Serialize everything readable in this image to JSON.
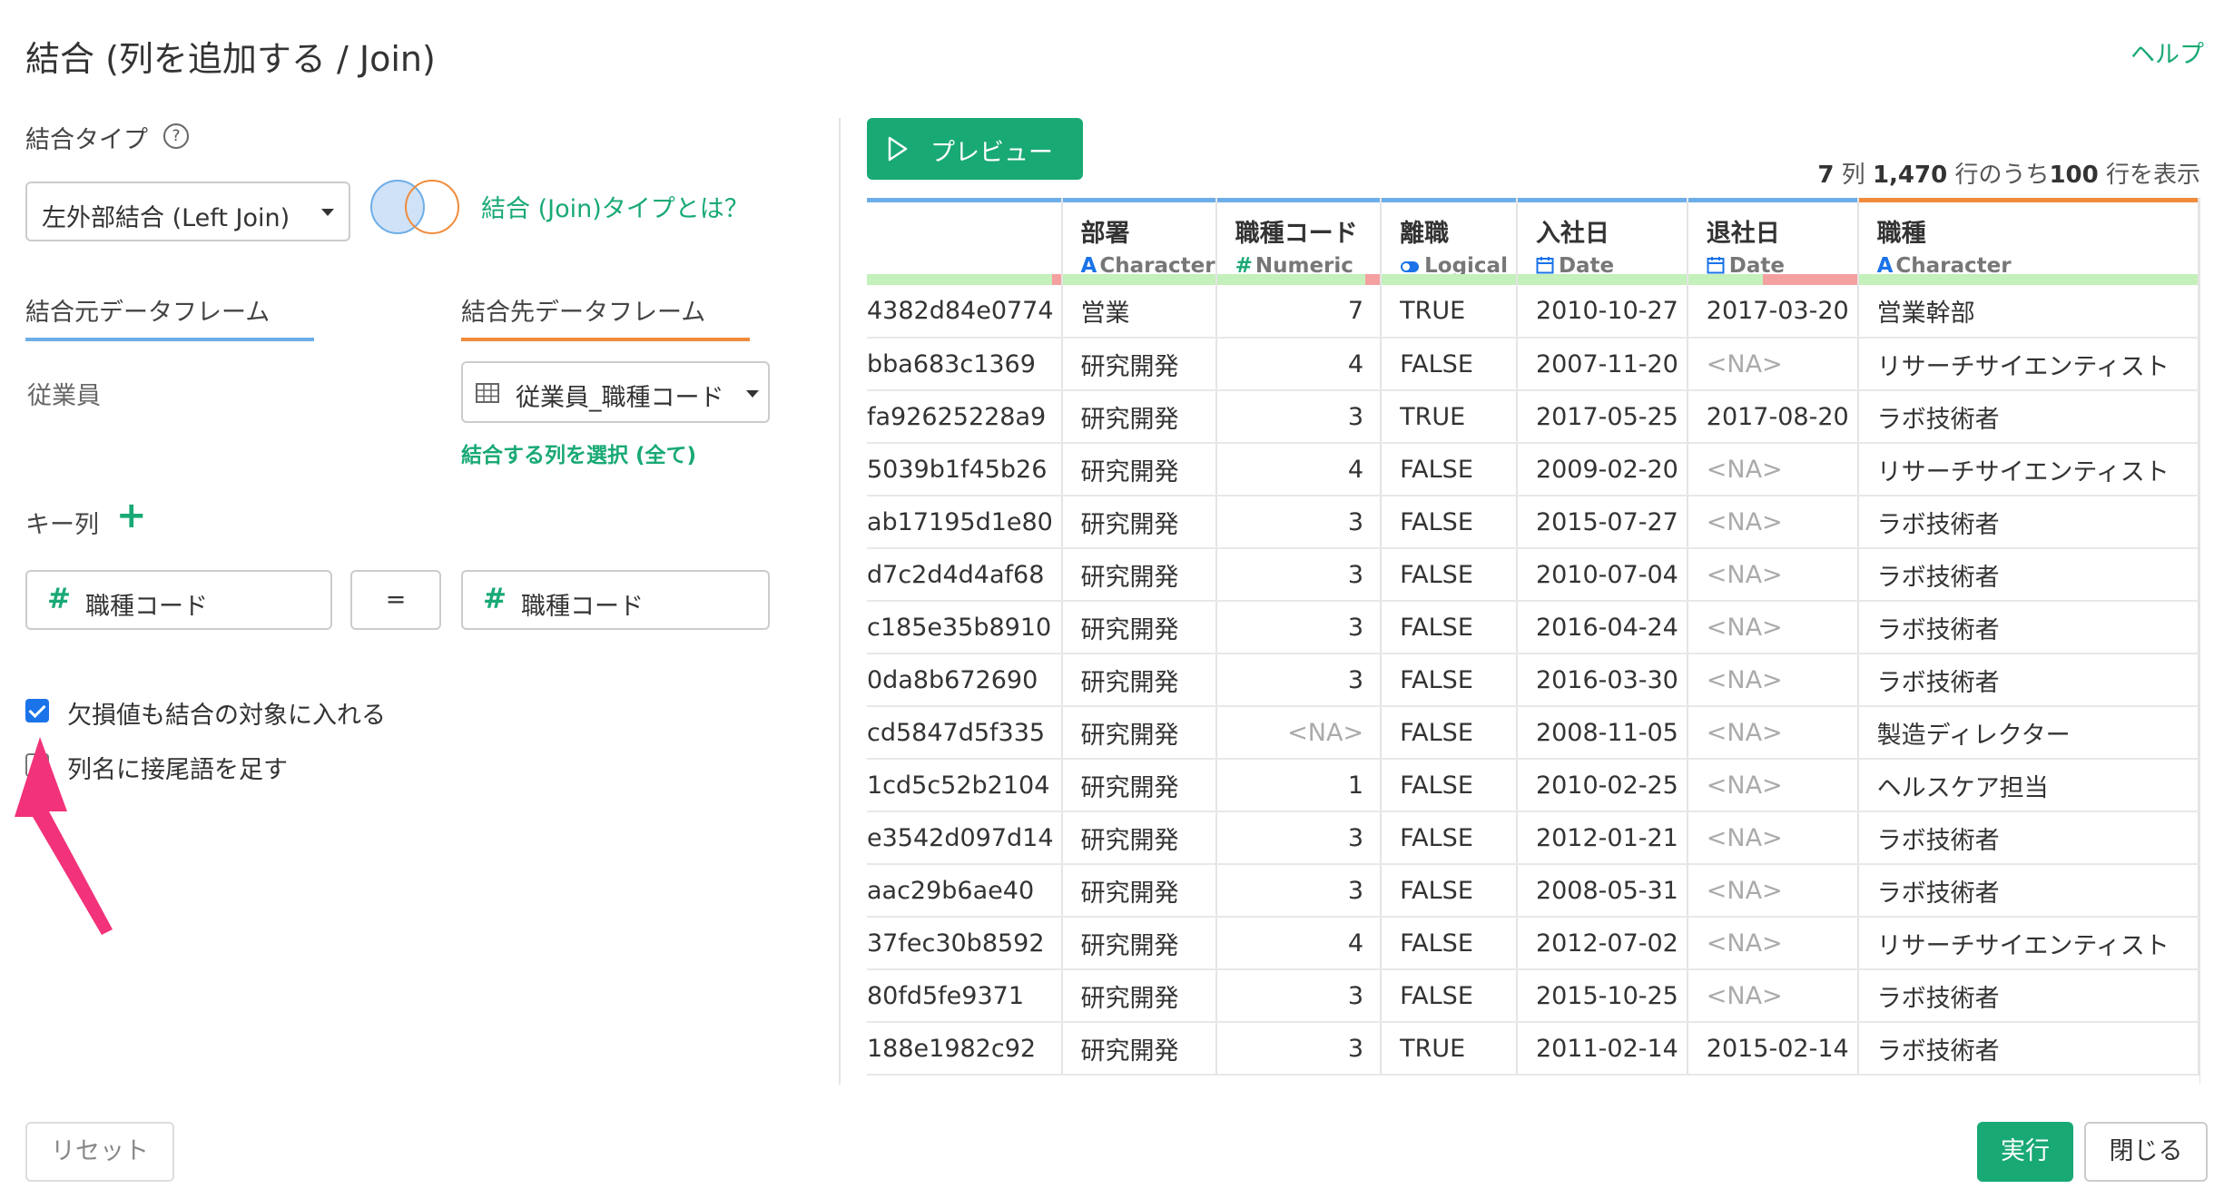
{
  "dialog": {
    "title": "結合 (列を追加する / Join)",
    "help": "ヘルプ"
  },
  "left": {
    "join_type_label": "結合タイプ",
    "help_icon": "?",
    "join_type_value": "左外部結合 (Left Join)",
    "join_type_link": "結合 (Join)タイプとは？",
    "source_label": "結合元データフレーム",
    "target_label": "結合先データフレーム",
    "source_value": "従業員",
    "target_value": "従業員_職種コード",
    "select_columns": "結合する列を選択 (全て)",
    "key_label": "キー列",
    "key_add": "+",
    "key_left": "職種コード",
    "key_eq": "=",
    "key_right": "職種コード",
    "hash": "#",
    "include_na_label": "欠損値も結合の対象に入れる",
    "include_na_checked": true,
    "suffix_label": "列名に接尾語を足す",
    "suffix_checked": false
  },
  "preview": {
    "button": "プレビュー",
    "summary_cols": "7",
    "summary_cols_unit": " 列  ",
    "summary_total": "1,470",
    "summary_mid": " 行のうち",
    "summary_shown": "100",
    "summary_end": " 行を表示"
  },
  "columns": [
    {
      "name": "",
      "type": "",
      "type_icon": ""
    },
    {
      "name": "部署",
      "type": "Character",
      "type_icon": "A"
    },
    {
      "name": "職種コード",
      "type": "Numeric",
      "type_icon": "#"
    },
    {
      "name": "離職",
      "type": "Logical",
      "type_icon": "toggle"
    },
    {
      "name": "入社日",
      "type": "Date",
      "type_icon": "calendar"
    },
    {
      "name": "退社日",
      "type": "Date",
      "type_icon": "calendar"
    },
    {
      "name": "職種",
      "type": "Character",
      "type_icon": "A"
    }
  ],
  "colors": {
    "accent": "#19a974",
    "source": "#6eaee8",
    "target": "#f08c3c",
    "checkbox": "#1a73e8"
  },
  "rows": [
    [
      "4382d84e0774",
      "営業",
      "7",
      "TRUE",
      "2010-10-27",
      "2017-03-20",
      "営業幹部"
    ],
    [
      "bba683c1369",
      "研究開発",
      "4",
      "FALSE",
      "2007-11-20",
      "<NA>",
      "リサーチサイエンティスト"
    ],
    [
      "fa92625228a9",
      "研究開発",
      "3",
      "TRUE",
      "2017-05-25",
      "2017-08-20",
      "ラボ技術者"
    ],
    [
      "5039b1f45b26",
      "研究開発",
      "4",
      "FALSE",
      "2009-02-20",
      "<NA>",
      "リサーチサイエンティスト"
    ],
    [
      "ab17195d1e80",
      "研究開発",
      "3",
      "FALSE",
      "2015-07-27",
      "<NA>",
      "ラボ技術者"
    ],
    [
      "d7c2d4d4af68",
      "研究開発",
      "3",
      "FALSE",
      "2010-07-04",
      "<NA>",
      "ラボ技術者"
    ],
    [
      "c185e35b8910",
      "研究開発",
      "3",
      "FALSE",
      "2016-04-24",
      "<NA>",
      "ラボ技術者"
    ],
    [
      "0da8b672690",
      "研究開発",
      "3",
      "FALSE",
      "2016-03-30",
      "<NA>",
      "ラボ技術者"
    ],
    [
      "cd5847d5f335",
      "研究開発",
      "<NA>",
      "FALSE",
      "2008-11-05",
      "<NA>",
      "製造ディレクター"
    ],
    [
      "1cd5c52b2104",
      "研究開発",
      "1",
      "FALSE",
      "2010-02-25",
      "<NA>",
      "ヘルスケア担当"
    ],
    [
      "e3542d097d14",
      "研究開発",
      "3",
      "FALSE",
      "2012-01-21",
      "<NA>",
      "ラボ技術者"
    ],
    [
      "aac29b6ae40",
      "研究開発",
      "3",
      "FALSE",
      "2008-05-31",
      "<NA>",
      "ラボ技術者"
    ],
    [
      "37fec30b8592",
      "研究開発",
      "4",
      "FALSE",
      "2012-07-02",
      "<NA>",
      "リサーチサイエンティスト"
    ],
    [
      "80fd5fe9371",
      "研究開発",
      "3",
      "FALSE",
      "2015-10-25",
      "<NA>",
      "ラボ技術者"
    ],
    [
      "188e1982c92",
      "研究開発",
      "3",
      "TRUE",
      "2011-02-14",
      "2015-02-14",
      "ラボ技術者"
    ]
  ],
  "footer": {
    "reset": "リセット",
    "run": "実行",
    "close": "閉じる"
  }
}
